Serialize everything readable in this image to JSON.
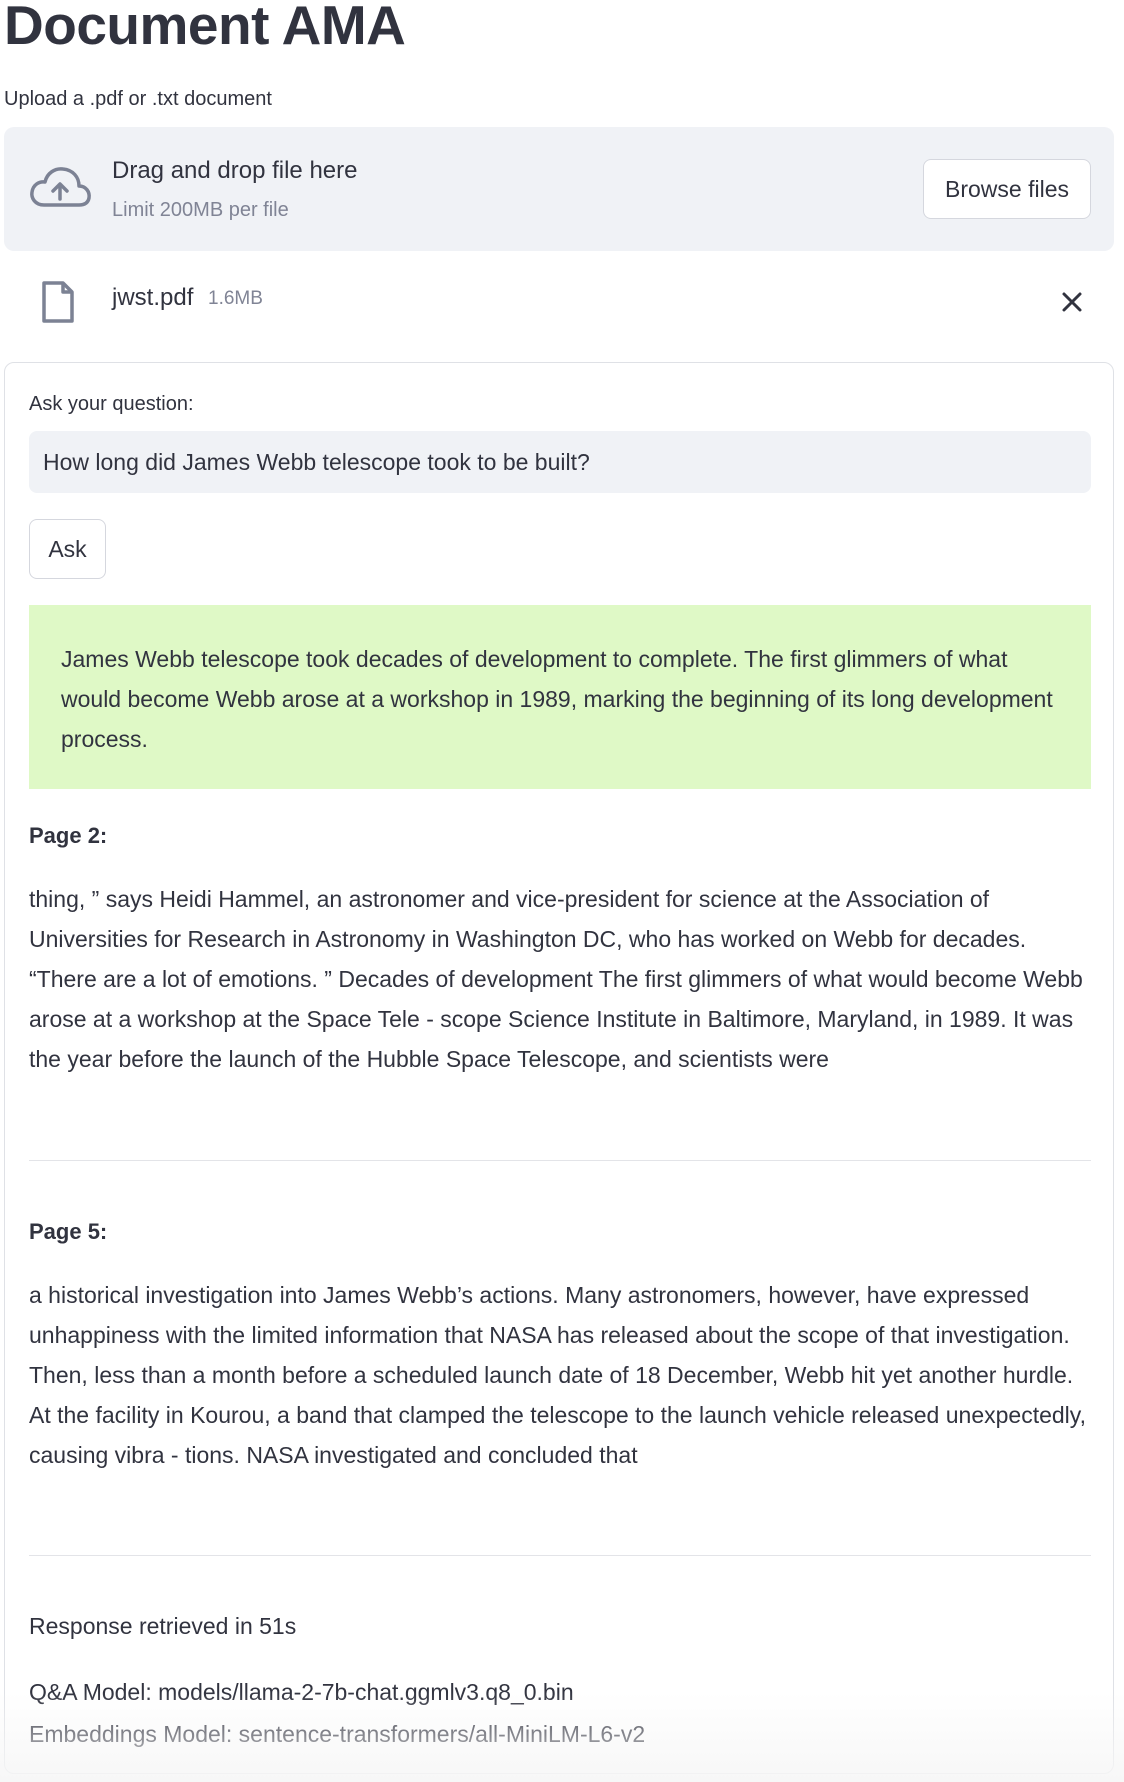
{
  "title": "Document AMA",
  "uploader": {
    "label": "Upload a .pdf or .txt document",
    "drop_text": "Drag and drop file here",
    "limit_text": "Limit 200MB per file",
    "browse_label": "Browse files"
  },
  "uploaded_file": {
    "name": "jwst.pdf",
    "size": "1.6MB"
  },
  "form": {
    "question_label": "Ask your question:",
    "question_value": "How long did James Webb telescope took to be built?",
    "ask_label": "Ask",
    "answer": "James Webb telescope took decades of development to complete. The first glimmers of what would become Webb arose at a workshop in 1989, marking the beginning of its long development process."
  },
  "sources": [
    {
      "heading": "Page 2:",
      "text": "thing, ” says Heidi Hammel, an astronomer and vice-president for science at the Association of Universities for Research in Astronomy in Washington DC, who has worked on Webb for decades. “There are a lot of emotions. ” Decades of development The first glimmers of what would become Webb arose at a workshop at the Space Tele - scope Science Institute in Baltimore, Maryland, in 1989. It was the year before the launch of the Hubble Space Telescope, and scientists were"
    },
    {
      "heading": "Page 5:",
      "text": "a historical investigation into James Webb’s actions. Many astronomers, however, have expressed unhappiness with the limited information that NASA has released about the scope of that investigation. Then, less than a month before a scheduled launch date of 18 December, Webb hit yet another hurdle. At the facility in Kourou, a band that clamped the telescope to the launch vehicle released unexpectedly, causing vibra - tions. NASA investigated and concluded that"
    }
  ],
  "footer": {
    "response_time": "Response retrieved in 51s",
    "qa_model": "Q&A Model: models/llama-2-7b-chat.ggmlv3.q8_0.bin",
    "embeddings_model": "Embeddings Model: sentence-transformers/all-MiniLM-L6-v2"
  },
  "icons": {
    "upload": "cloud-upload-icon",
    "file": "file-icon",
    "remove": "close-icon"
  },
  "colors": {
    "answer_background": "#dff9c6",
    "dropzone_background": "#f0f2f6",
    "text": "#31333f",
    "muted_text": "#808495"
  }
}
